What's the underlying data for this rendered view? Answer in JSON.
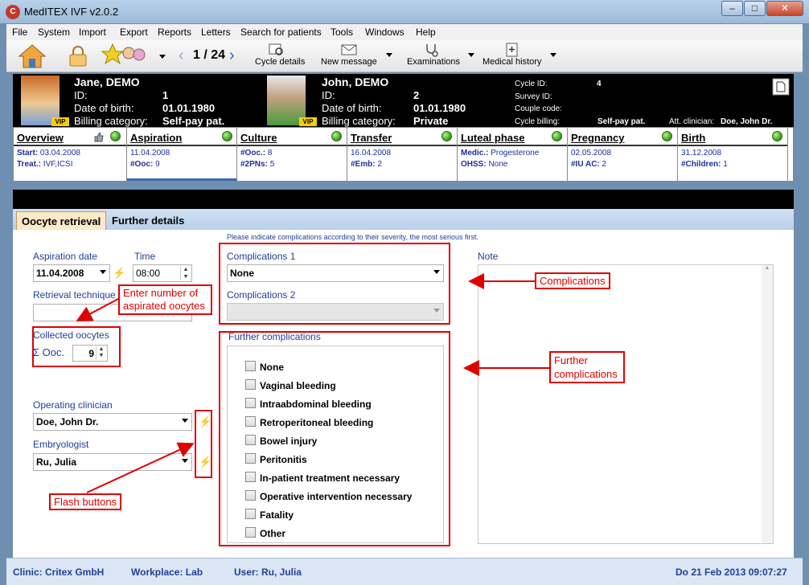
{
  "window": {
    "title": "MedITEX IVF v2.0.2",
    "app_icon": "C",
    "min": "–",
    "max": "□",
    "close": "✕"
  },
  "menu": [
    "File",
    "System",
    "Import",
    "Export",
    "Reports",
    "Letters",
    "Search for patients",
    "Tools",
    "Windows",
    "Help"
  ],
  "toolbar": {
    "icons": [
      "home-icon",
      "lock-icon",
      "couple-icon"
    ],
    "prev": "‹",
    "next": "›",
    "pager": "1 / 24",
    "buttons": [
      "Cycle details",
      "New message",
      "Examinations",
      "Medical history"
    ]
  },
  "patient_female": {
    "name": "Jane, DEMO",
    "vip": "VIP",
    "id_label": "ID:",
    "id": "1",
    "dob_label": "Date of birth:",
    "dob": "01.01.1980",
    "billing_label": "Billing category:",
    "billing": "Self-pay pat."
  },
  "patient_male": {
    "name": "John, DEMO",
    "vip": "VIP",
    "id_label": "ID:",
    "id": "2",
    "dob_label": "Date of birth:",
    "dob": "01.01.1980",
    "billing_label": "Billing category:",
    "billing": "Private"
  },
  "cycle": {
    "cycle_id_label": "Cycle ID:",
    "cycle_id": "4",
    "survey_label": "Survey ID:",
    "couple_label": "Couple code:",
    "billing_label": "Cycle billing:",
    "billing": "Self-pay pat.",
    "att_clinician": "Att. clinician:",
    "att_clinician_val": "Doe, John Dr."
  },
  "phases": [
    {
      "title": "Overview",
      "lines": [
        {
          "k": "Start:",
          "v": "03.04.2008"
        },
        {
          "k": "Treat.:",
          "v": "IVF,ICSI"
        }
      ]
    },
    {
      "title": "Aspiration",
      "lines": [
        {
          "k": "",
          "v": "11.04.2008"
        },
        {
          "k": "#Ooc:",
          "v": "9"
        }
      ]
    },
    {
      "title": "Culture",
      "lines": [
        {
          "k": "#Ooc.:",
          "v": "8"
        },
        {
          "k": "#2PNs:",
          "v": "5"
        }
      ]
    },
    {
      "title": "Transfer",
      "lines": [
        {
          "k": "",
          "v": "16.04.2008"
        },
        {
          "k": "#Emb:",
          "v": "2"
        }
      ]
    },
    {
      "title": "Luteal phase",
      "lines": [
        {
          "k": "Medic.:",
          "v": "Progesterone"
        },
        {
          "k": "OHSS:",
          "v": "None"
        }
      ]
    },
    {
      "title": "Pregnancy",
      "lines": [
        {
          "k": "",
          "v": "02.05.2008"
        },
        {
          "k": "#IU AC:",
          "v": "2"
        }
      ]
    },
    {
      "title": "Birth",
      "lines": [
        {
          "k": "",
          "v": "31.12.2008"
        },
        {
          "k": "#Children:",
          "v": "1"
        }
      ]
    }
  ],
  "tabs": [
    "Oocyte retrieval",
    "Further details"
  ],
  "form": {
    "hint": "Please indicate complications according to their severity, the most serious first.",
    "aspiration_date_label": "Aspiration date",
    "aspiration_date": "11.04.2008",
    "time_label": "Time",
    "time": "08:00",
    "retrieval_label": "Retrieval technique",
    "collected_label": "Collected oocytes",
    "ooc_label": "Σ Ooc.",
    "ooc_value": "9",
    "operating_label": "Operating clinician",
    "operating_value": "Doe, John Dr.",
    "embryologist_label": "Embryologist",
    "embryologist_value": "Ru, Julia",
    "comp1_label": "Complications 1",
    "comp1_value": "None",
    "comp2_label": "Complications 2",
    "further_label": "Further complications",
    "note_label": "Note",
    "checkboxes": [
      "None",
      "Vaginal bleeding",
      "Intraabdominal bleeding",
      "Retroperitoneal bleeding",
      "Bowel injury",
      "Peritonitis",
      "In-patient treatment necessary",
      "Operative intervention necessary",
      "Fatality",
      "Other"
    ]
  },
  "callouts": {
    "enter_number_1": "Enter number of",
    "enter_number_2": "aspirated oocytes",
    "complications": "Complications",
    "further_1": "Further",
    "further_2": "complications",
    "flash": "Flash buttons"
  },
  "status": {
    "clinic": "Clinic: Critex GmbH",
    "workplace": "Workplace: Lab",
    "user": "User: Ru, Julia",
    "datetime": "Do 21 Feb 2013 09:07:27"
  },
  "colors": {
    "accent": "#1f3f9a",
    "annotation": "#e00000",
    "phase_ok": "#2e9a10"
  }
}
